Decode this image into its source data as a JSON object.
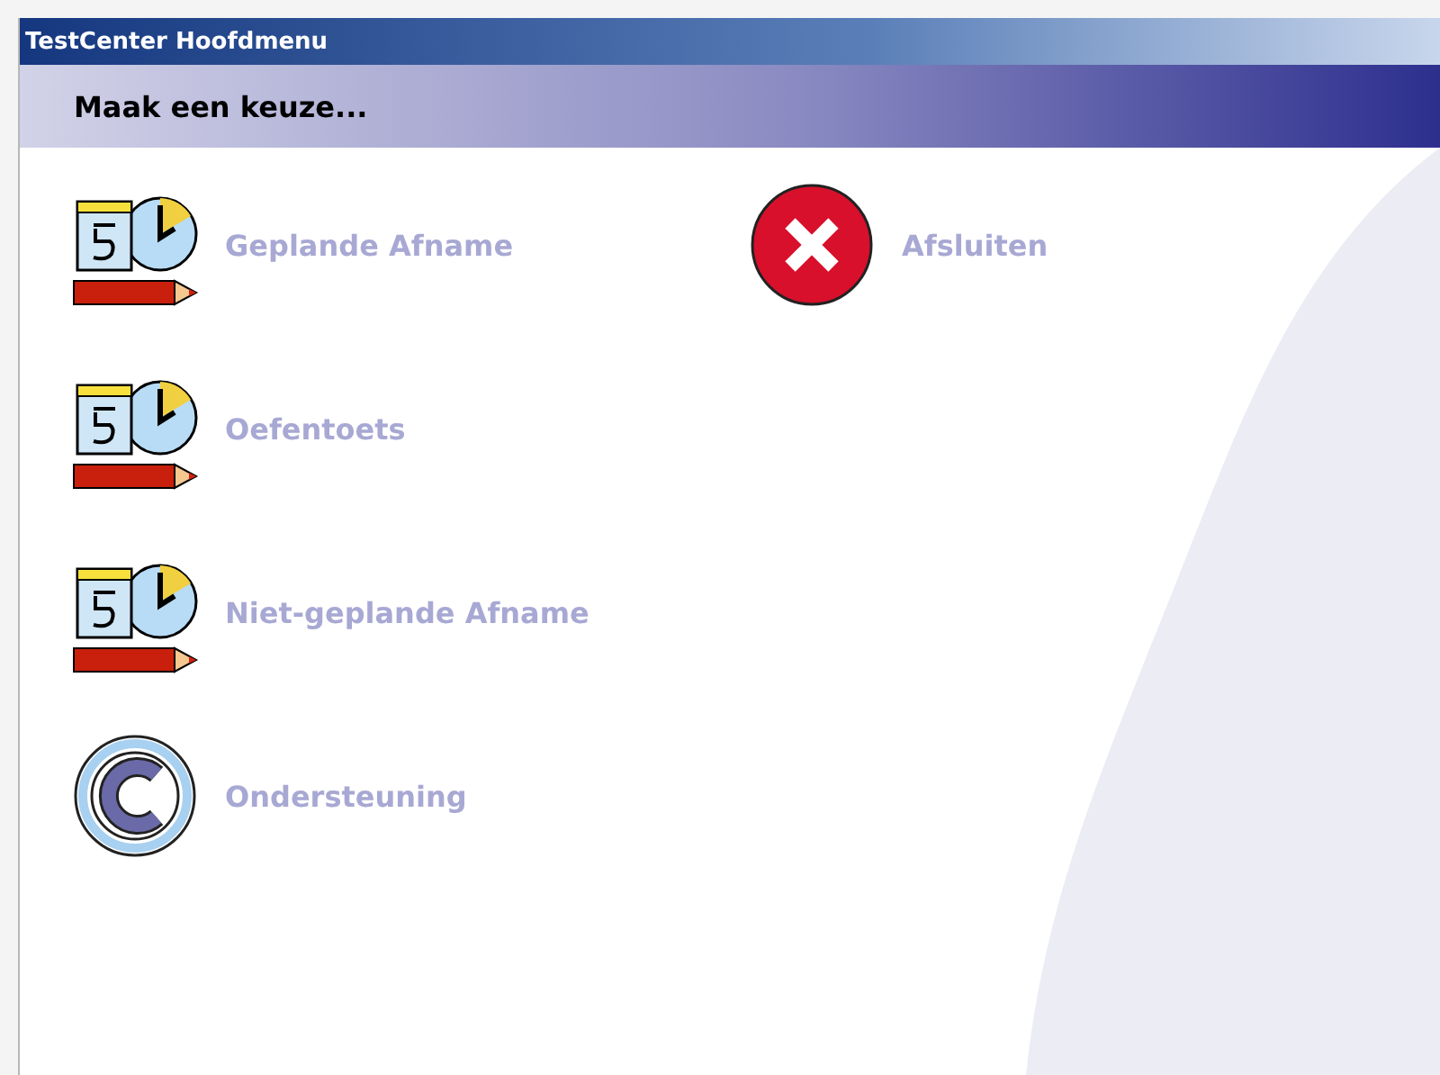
{
  "window": {
    "title": "TestCenter Hoofdmenu"
  },
  "header": {
    "text": "Maak een keuze..."
  },
  "menu_columns": [
    {
      "items": [
        {
          "kind": "schedule",
          "label": "Geplande Afname"
        },
        {
          "kind": "schedule",
          "label": "Oefentoets"
        },
        {
          "kind": "schedule",
          "label": "Niet-geplande Afname"
        },
        {
          "kind": "support",
          "label": "Ondersteuning"
        }
      ]
    },
    {
      "items": [
        {
          "kind": "close",
          "label": "Afsluiten"
        }
      ]
    }
  ]
}
